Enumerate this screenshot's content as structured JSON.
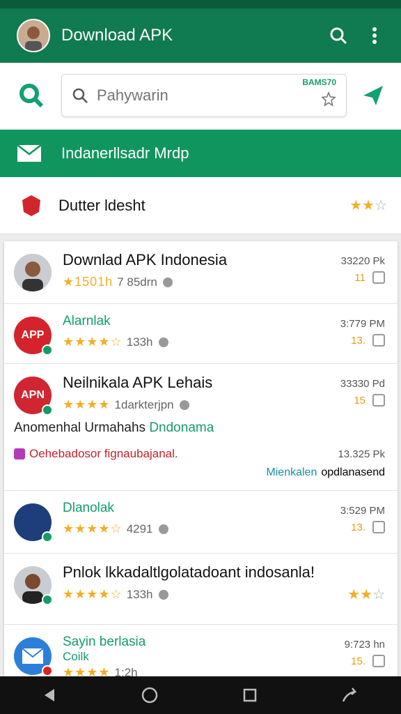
{
  "appbar": {
    "title": "Download APK"
  },
  "search": {
    "placeholder": "Pahywarin",
    "tag": "BAMS70"
  },
  "banner": {
    "title": "Indanerllsadr Mrdp"
  },
  "filter": {
    "title": "Dutter ldesht"
  },
  "items": [
    {
      "name": "Downlad APK Indonesia",
      "stars": "★1501h",
      "meta": "7 85drn",
      "time": "33220 Pk",
      "count": "11"
    },
    {
      "name": "Alarnlak",
      "stars": "★★★★☆",
      "meta": "133h",
      "time": "3:779 PM",
      "count": "13.",
      "avatar": "APP"
    },
    {
      "name": "Neilnikala APK Lehais",
      "stars": "★★★★",
      "meta": "1darkterjpn",
      "time": "33330 Pd",
      "count": "15",
      "avatar": "APN",
      "sub1a": "Anomenhal Urmahahs ",
      "sub1b": "Dndonama",
      "sub2": "Oehebadosor fignaubajanal.",
      "sub2time": "13.325 Pk",
      "sub3a": "Mienkalen",
      "sub3b": "opdlanasend"
    },
    {
      "name": "Dlanolak",
      "stars": "★★★★☆",
      "meta": "4291",
      "time": "3:529 PM",
      "count": "13."
    },
    {
      "name": "Pnlok lkkadaltlgolatadoant indosanla!",
      "stars": "★★★★☆",
      "meta": "133h",
      "time": "",
      "count": ""
    },
    {
      "name": "Sayin berlasia",
      "name2": "Coilk",
      "stars": "★★★★",
      "meta": "1:2h",
      "time": "9:723 hn",
      "count": "15."
    }
  ]
}
